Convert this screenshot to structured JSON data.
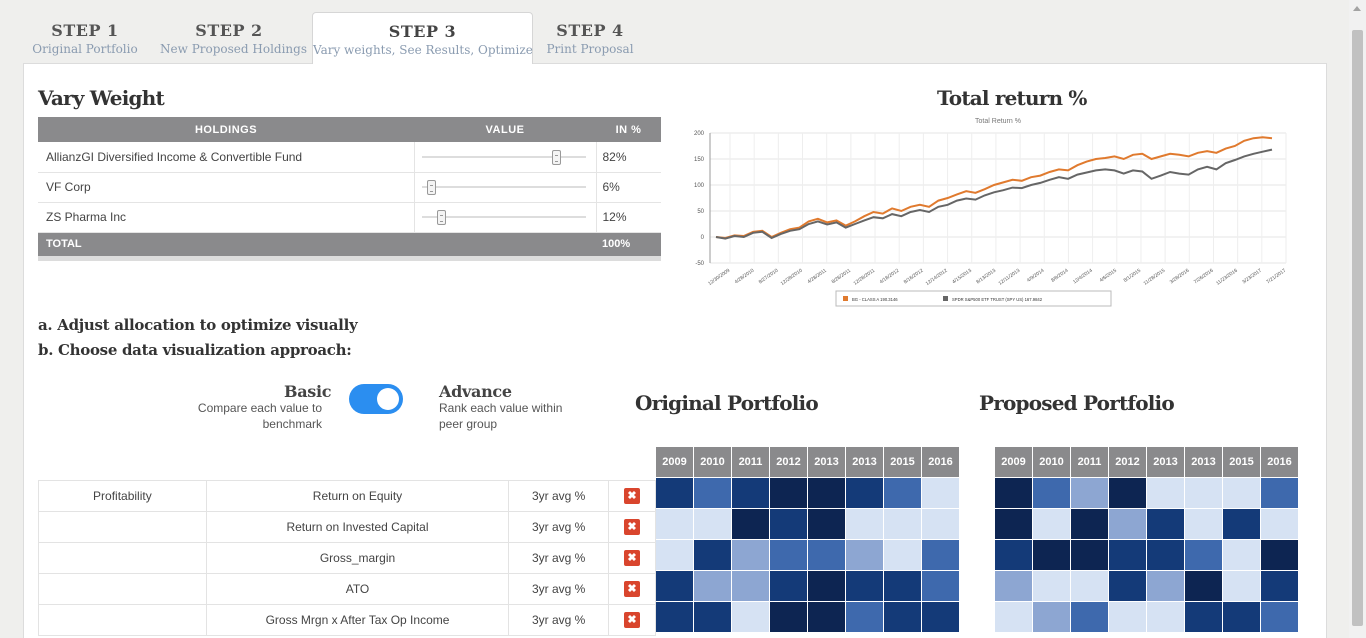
{
  "tabs": [
    {
      "step": "STEP 1",
      "label": "Original Portfolio",
      "active": false
    },
    {
      "step": "STEP 2",
      "label": "New Proposed Holdings",
      "active": false
    },
    {
      "step": "STEP 3",
      "label": "Vary weights, See Results, Optimize",
      "active": true
    },
    {
      "step": "STEP 4",
      "label": "Print Proposal",
      "active": false
    }
  ],
  "vary_weight": {
    "title": "Vary Weight",
    "headers": [
      "HOLDINGS",
      "VALUE",
      "IN %"
    ],
    "rows": [
      {
        "name": "AllianzGI Diversified Income & Convertible Fund",
        "weight": 0.82,
        "pct": "82%"
      },
      {
        "name": "VF Corp",
        "weight": 0.06,
        "pct": "6%"
      },
      {
        "name": "ZS Pharma Inc",
        "weight": 0.12,
        "pct": "12%"
      }
    ],
    "total_label": "TOTAL",
    "total_pct": "100%"
  },
  "total_return": {
    "title": "Total return %",
    "chart_data": {
      "type": "line",
      "title": "Total Return %",
      "ylim": [
        -50,
        200
      ],
      "yticks": [
        "-50",
        "0",
        "50",
        "100",
        "150",
        "200"
      ],
      "xticks": [
        "12/30/2009",
        "4/28/2010",
        "8/27/2010",
        "12/28/2010",
        "4/28/2011",
        "8/26/2011",
        "12/28/2011",
        "4/18/2012",
        "8/16/2012",
        "12/14/2012",
        "4/15/2013",
        "8/13/2013",
        "12/11/2013",
        "4/9/2014",
        "8/8/2014",
        "12/4/2014",
        "4/6/2015",
        "8/1/2015",
        "11/28/2015",
        "3/28/2016",
        "7/26/2016",
        "11/23/2016",
        "3/23/2017",
        "7/21/2017"
      ],
      "series": [
        {
          "name": "BG - CLASS A 190.3146",
          "color": "#e07a2e",
          "values": [
            0,
            -2,
            3,
            2,
            10,
            12,
            0,
            8,
            15,
            18,
            30,
            35,
            28,
            32,
            22,
            30,
            40,
            48,
            45,
            55,
            50,
            58,
            62,
            58,
            70,
            75,
            82,
            88,
            85,
            92,
            100,
            105,
            110,
            108,
            115,
            118,
            125,
            130,
            128,
            138,
            145,
            150,
            152,
            155,
            150,
            158,
            160,
            150,
            155,
            160,
            158,
            155,
            162,
            165,
            162,
            170,
            175,
            185,
            190,
            192,
            190
          ]
        },
        {
          "name": "SPDR S&P500 ETF TRUST (SPY US) 167.9842",
          "color": "#666666",
          "values": [
            0,
            -3,
            2,
            0,
            8,
            10,
            -2,
            6,
            12,
            15,
            25,
            30,
            24,
            28,
            18,
            25,
            32,
            38,
            36,
            44,
            40,
            48,
            52,
            48,
            58,
            62,
            70,
            74,
            72,
            80,
            86,
            90,
            95,
            94,
            100,
            104,
            110,
            115,
            112,
            120,
            124,
            128,
            130,
            128,
            122,
            128,
            126,
            112,
            118,
            125,
            122,
            120,
            130,
            135,
            130,
            142,
            148,
            155,
            160,
            164,
            168
          ]
        }
      ]
    }
  },
  "instructions": {
    "a": "a. Adjust allocation to optimize visually",
    "b": "b. Choose data visualization approach:"
  },
  "toggle": {
    "left_title": "Basic",
    "left_desc_1": "Compare each value to",
    "left_desc_2": "benchmark",
    "right_title": "Advance",
    "right_desc_1": "Rank each value within",
    "right_desc_2": "peer group",
    "on": true,
    "color": "#2b8ef0"
  },
  "original_title": "Original Portfolio",
  "proposed_title": "Proposed Portfolio",
  "years": [
    "2009",
    "2010",
    "2011",
    "2012",
    "2013",
    "2013",
    "2015",
    "2016"
  ],
  "metrics": [
    {
      "category": "Profitability",
      "name": "Return on Equity",
      "period": "3yr avg %"
    },
    {
      "category": "",
      "name": "Return on Invested Capital",
      "period": "3yr avg %"
    },
    {
      "category": "",
      "name": "Gross_margin",
      "period": "3yr avg %"
    },
    {
      "category": "",
      "name": "ATO",
      "period": "3yr avg %"
    },
    {
      "category": "",
      "name": "Gross Mrgn x After Tax Op Income",
      "period": "3yr avg %"
    }
  ],
  "remove_icon": "close-icon",
  "heat_levels": [
    "#d6e2f3",
    "#8da6d2",
    "#3e69ad",
    "#143a78",
    "#0d2552"
  ],
  "original_heat": [
    [
      3,
      2,
      3,
      4,
      4,
      3,
      2,
      0
    ],
    [
      0,
      0,
      4,
      3,
      4,
      0,
      0,
      0
    ],
    [
      0,
      3,
      1,
      2,
      2,
      1,
      0,
      2
    ],
    [
      3,
      1,
      1,
      3,
      4,
      3,
      3,
      2
    ],
    [
      3,
      3,
      0,
      4,
      4,
      2,
      3,
      3
    ]
  ],
  "proposed_heat": [
    [
      4,
      2,
      1,
      4,
      0,
      0,
      0,
      2
    ],
    [
      4,
      0,
      4,
      1,
      3,
      0,
      3,
      0
    ],
    [
      3,
      4,
      4,
      3,
      3,
      2,
      0,
      4
    ],
    [
      1,
      0,
      0,
      3,
      1,
      4,
      0,
      3
    ],
    [
      0,
      1,
      2,
      0,
      0,
      3,
      3,
      2
    ]
  ]
}
